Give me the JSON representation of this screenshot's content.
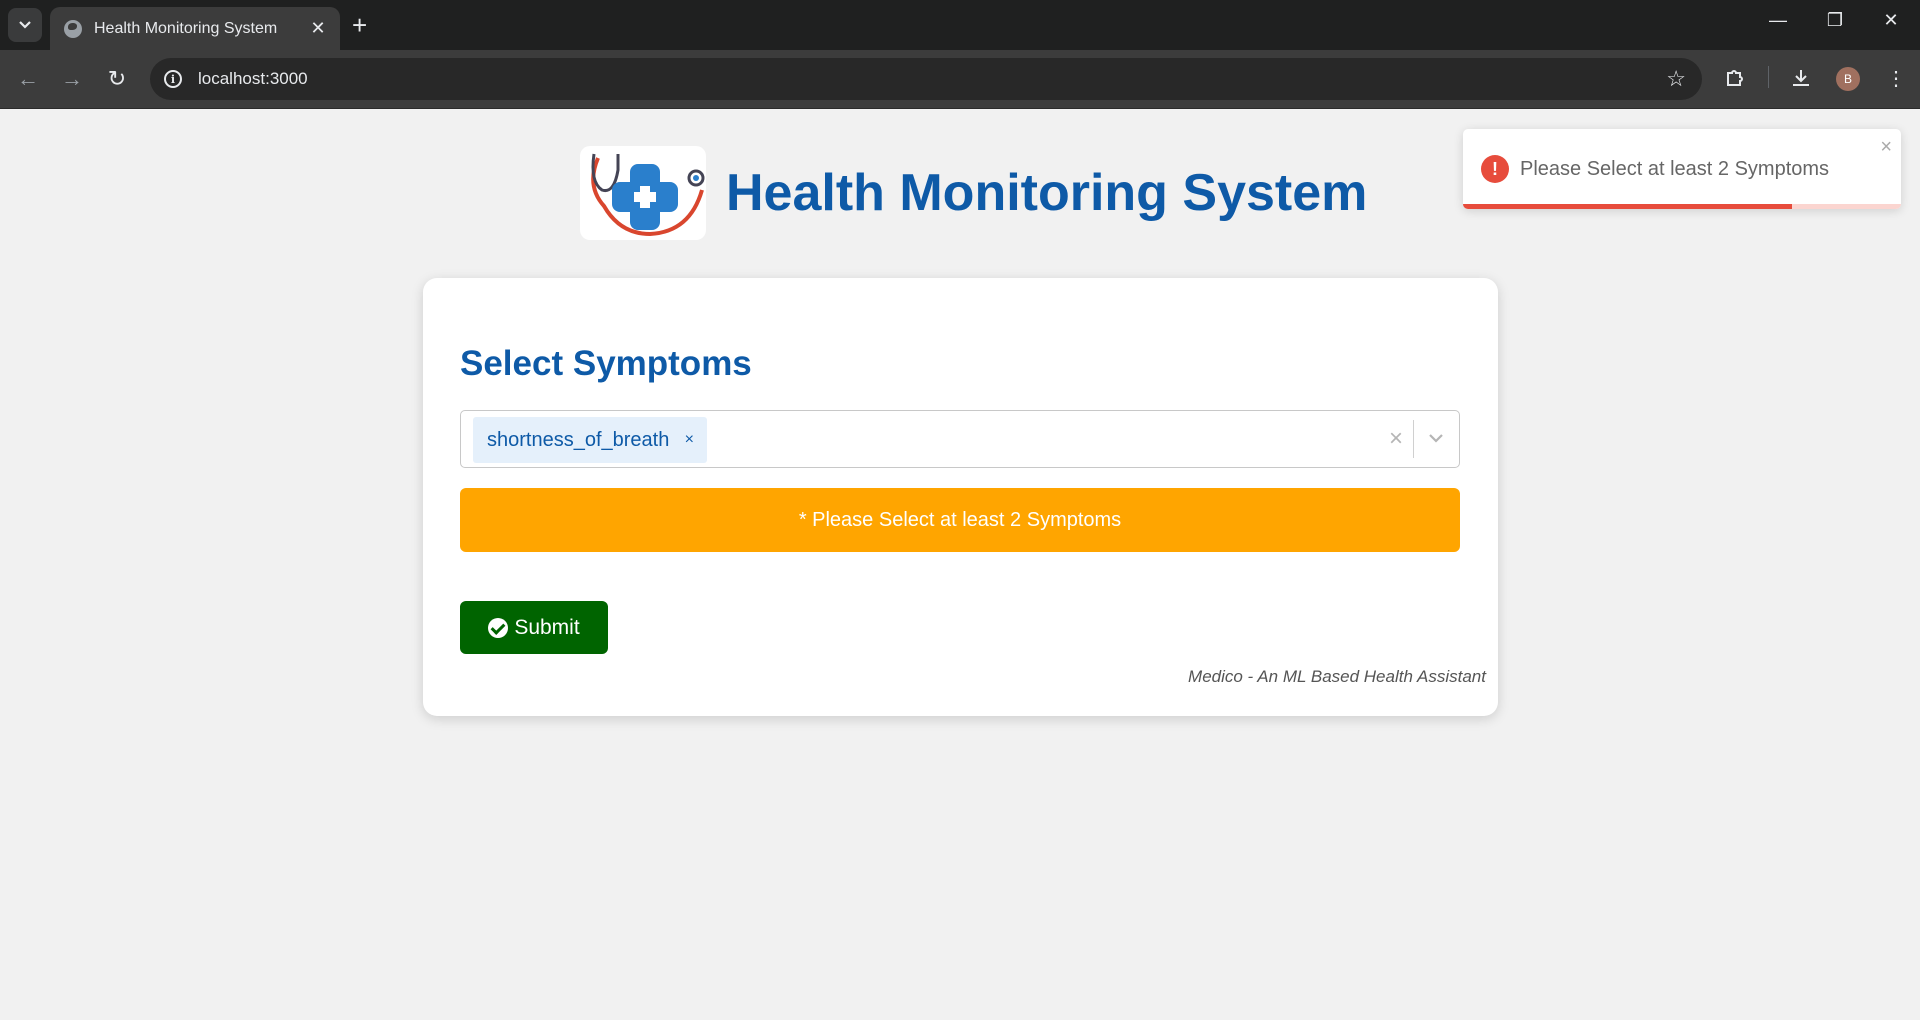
{
  "browser": {
    "tab_title": "Health Monitoring System",
    "url": "localhost:3000",
    "profile_initial": "B",
    "icons": {
      "tab_menu": "chevron-down-icon",
      "tab_close": "close-icon",
      "new_tab": "plus-icon",
      "back": "arrow-left-icon",
      "forward": "arrow-right-icon",
      "reload": "reload-icon",
      "site_info": "info-icon",
      "bookmark": "star-icon",
      "extensions": "puzzle-icon",
      "downloads": "download-icon",
      "menu": "kebab-menu-icon"
    }
  },
  "header": {
    "title": "Health Monitoring System",
    "logo_icon": "medical-cross-stethoscope-logo"
  },
  "form": {
    "title": "Select Symptoms",
    "selected_symptoms": [
      {
        "label": "shortness_of_breath",
        "remove_label": "×"
      }
    ],
    "clear_label": "×",
    "warning": "* Please Select at least 2 Symptoms",
    "submit_label": "Submit",
    "footer_note": "Medico - An ML Based Health Assistant"
  },
  "toast": {
    "message": "Please Select at least 2 Symptoms",
    "type": "error",
    "icon": "exclamation-icon",
    "close_label": "×",
    "progress_remaining": 0.75
  },
  "colors": {
    "brand_blue": "#0e5aa7",
    "warning_orange": "#ffa500",
    "submit_green": "#006400",
    "error_red": "#e74c3c",
    "chip_bg": "#e5f0fb"
  }
}
